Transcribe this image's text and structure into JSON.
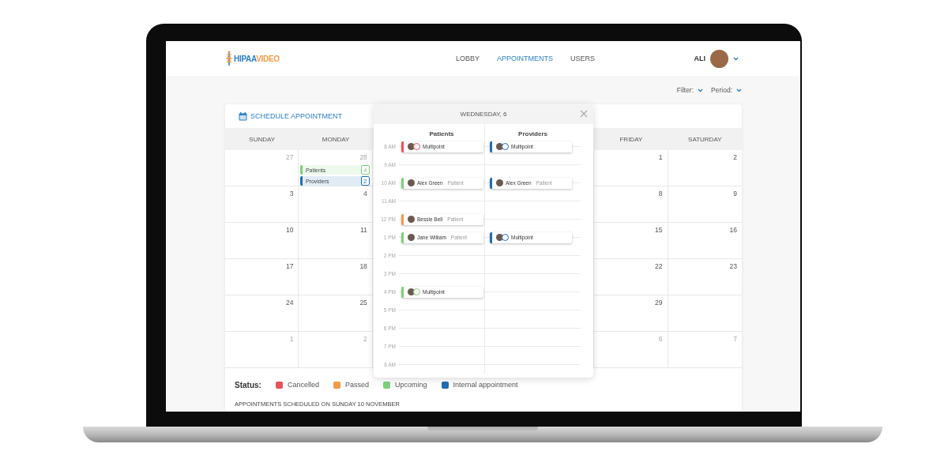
{
  "logo": [
    "HIPAA",
    "VIDEO"
  ],
  "nav": [
    {
      "label": "LOBBY",
      "selected": false
    },
    {
      "label": "APPOINTMENTS",
      "selected": true
    },
    {
      "label": "USERS",
      "selected": false
    }
  ],
  "user": {
    "name": "ALI"
  },
  "filters": [
    "Filter:",
    "Period:"
  ],
  "calendar": {
    "title": "SCHEDULE APPOINTMENT",
    "weekdays": {
      "left": [
        "SUNDAY",
        "MONDAY"
      ],
      "right": [
        "FRIDAY",
        "SATURDAY"
      ]
    },
    "weeks": [
      {
        "left": [
          {
            "day": "27",
            "muted": true
          },
          {
            "day": "28",
            "muted": true,
            "events": [
              {
                "label": "Patients",
                "count": "4",
                "color": "#7dd17c"
              },
              {
                "label": "Providers",
                "count": "2",
                "color": "#1f6db5"
              }
            ]
          }
        ],
        "right": [
          {
            "day": "1",
            "muted": false
          },
          {
            "day": "2",
            "muted": false
          }
        ]
      },
      {
        "left": [
          {
            "day": "3",
            "muted": false
          },
          {
            "day": "4",
            "muted": false
          }
        ],
        "right": [
          {
            "day": "8",
            "muted": false
          },
          {
            "day": "9",
            "muted": false
          }
        ]
      },
      {
        "left": [
          {
            "day": "10",
            "muted": false
          },
          {
            "day": "11",
            "muted": false
          }
        ],
        "right": [
          {
            "day": "15",
            "muted": false
          },
          {
            "day": "16",
            "muted": false
          }
        ]
      },
      {
        "left": [
          {
            "day": "17",
            "muted": false
          },
          {
            "day": "18",
            "muted": false
          }
        ],
        "right": [
          {
            "day": "22",
            "muted": false
          },
          {
            "day": "23",
            "muted": false
          }
        ]
      },
      {
        "left": [
          {
            "day": "24",
            "muted": false
          },
          {
            "day": "25",
            "muted": false
          }
        ],
        "right": [
          {
            "day": "29",
            "muted": false
          }
        ]
      },
      {
        "left": [
          {
            "day": "1",
            "muted": true
          },
          {
            "day": "2",
            "muted": true
          }
        ],
        "right": [
          {
            "day": "6",
            "muted": true
          },
          {
            "day": "7",
            "muted": true
          }
        ]
      }
    ]
  },
  "status": {
    "label": "Status:",
    "items": [
      {
        "label": "Cancelled",
        "color": "#e8525a"
      },
      {
        "label": "Passed",
        "color": "#f39a45"
      },
      {
        "label": "Upcoming",
        "color": "#7dd17c"
      },
      {
        "label": "Internal appointment",
        "color": "#1f6db5"
      }
    ]
  },
  "footer_text": "APPOINTMENTS SCHEDULED ON SUNDAY 10 NOVEMBER",
  "day_popup": {
    "title": "WEDNESDAY, 6",
    "columns": [
      "Patients",
      "Providers"
    ],
    "hours": [
      {
        "label": "8 AM",
        "patient": {
          "kind": "group",
          "name": "Multipoint",
          "color": "#e8525a"
        },
        "provider": {
          "kind": "group",
          "name": "Multipoint",
          "color": "#1f6db5"
        }
      },
      {
        "label": "9 AM"
      },
      {
        "label": "10 AM",
        "patient": {
          "kind": "single",
          "name": "Alex Green",
          "role": "Patient",
          "color": "#7dd17c"
        },
        "provider": {
          "kind": "single",
          "name": "Alex Green",
          "role": "Patient",
          "color": "#1f6db5"
        }
      },
      {
        "label": "11 AM"
      },
      {
        "label": "12 PM",
        "patient": {
          "kind": "single",
          "name": "Bessie Bell",
          "role": "Patient",
          "color": "#f39a45"
        }
      },
      {
        "label": "1 PM",
        "patient": {
          "kind": "single",
          "name": "Jane William",
          "role": "Patient",
          "color": "#7dd17c"
        },
        "provider": {
          "kind": "group",
          "name": "Multipoint",
          "color": "#1f6db5"
        }
      },
      {
        "label": "2 PM"
      },
      {
        "label": "3 PM"
      },
      {
        "label": "4 PM",
        "patient": {
          "kind": "group",
          "name": "Multipoint",
          "color": "#7dd17c"
        }
      },
      {
        "label": "5 PM"
      },
      {
        "label": "6 PM"
      },
      {
        "label": "7 PM"
      },
      {
        "label": "8 AM"
      }
    ]
  }
}
